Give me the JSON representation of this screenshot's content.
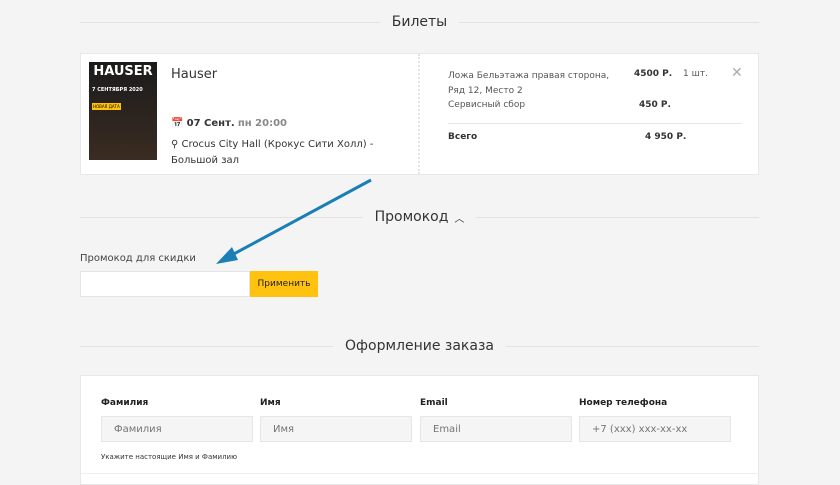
{
  "tickets_section": {
    "title": "Билеты"
  },
  "event": {
    "poster_text": "HAUSER",
    "poster_date": "7 СЕНТЯБРЯ 2020",
    "poster_badge": "НОВАЯ ДАТА",
    "name": "Hauser",
    "date": "07 Сент.",
    "weekday_time": "пн 20:00",
    "venue": "Crocus City Hall (Крокус Сити Холл) - Большой зал"
  },
  "order": {
    "seat": "Ложа Бельэтажа правая сторона, Ряд 12, Место 2",
    "price": "4500 Р.",
    "qty": "1 шт.",
    "fee_label": "Сервисный сбор",
    "fee": "450 Р.",
    "total_label": "Всего",
    "total": "4 950 Р."
  },
  "promo": {
    "title": "Промокод",
    "label": "Промокод для скидки",
    "value": "",
    "apply": "Применить",
    "accent": "#ffc20e"
  },
  "checkout": {
    "title": "Оформление заказа",
    "fields": [
      {
        "label": "Фамилия",
        "placeholder": "Фамилия"
      },
      {
        "label": "Имя",
        "placeholder": "Имя"
      },
      {
        "label": "Email",
        "placeholder": "Email"
      },
      {
        "label": "Номер телефона",
        "placeholder": "+7 (xxx) xxx-xx-xx"
      }
    ],
    "hint": "Укажите настоящие Имя и Фамилию"
  },
  "annotation": {
    "arrow_color": "#1a7fb5"
  }
}
